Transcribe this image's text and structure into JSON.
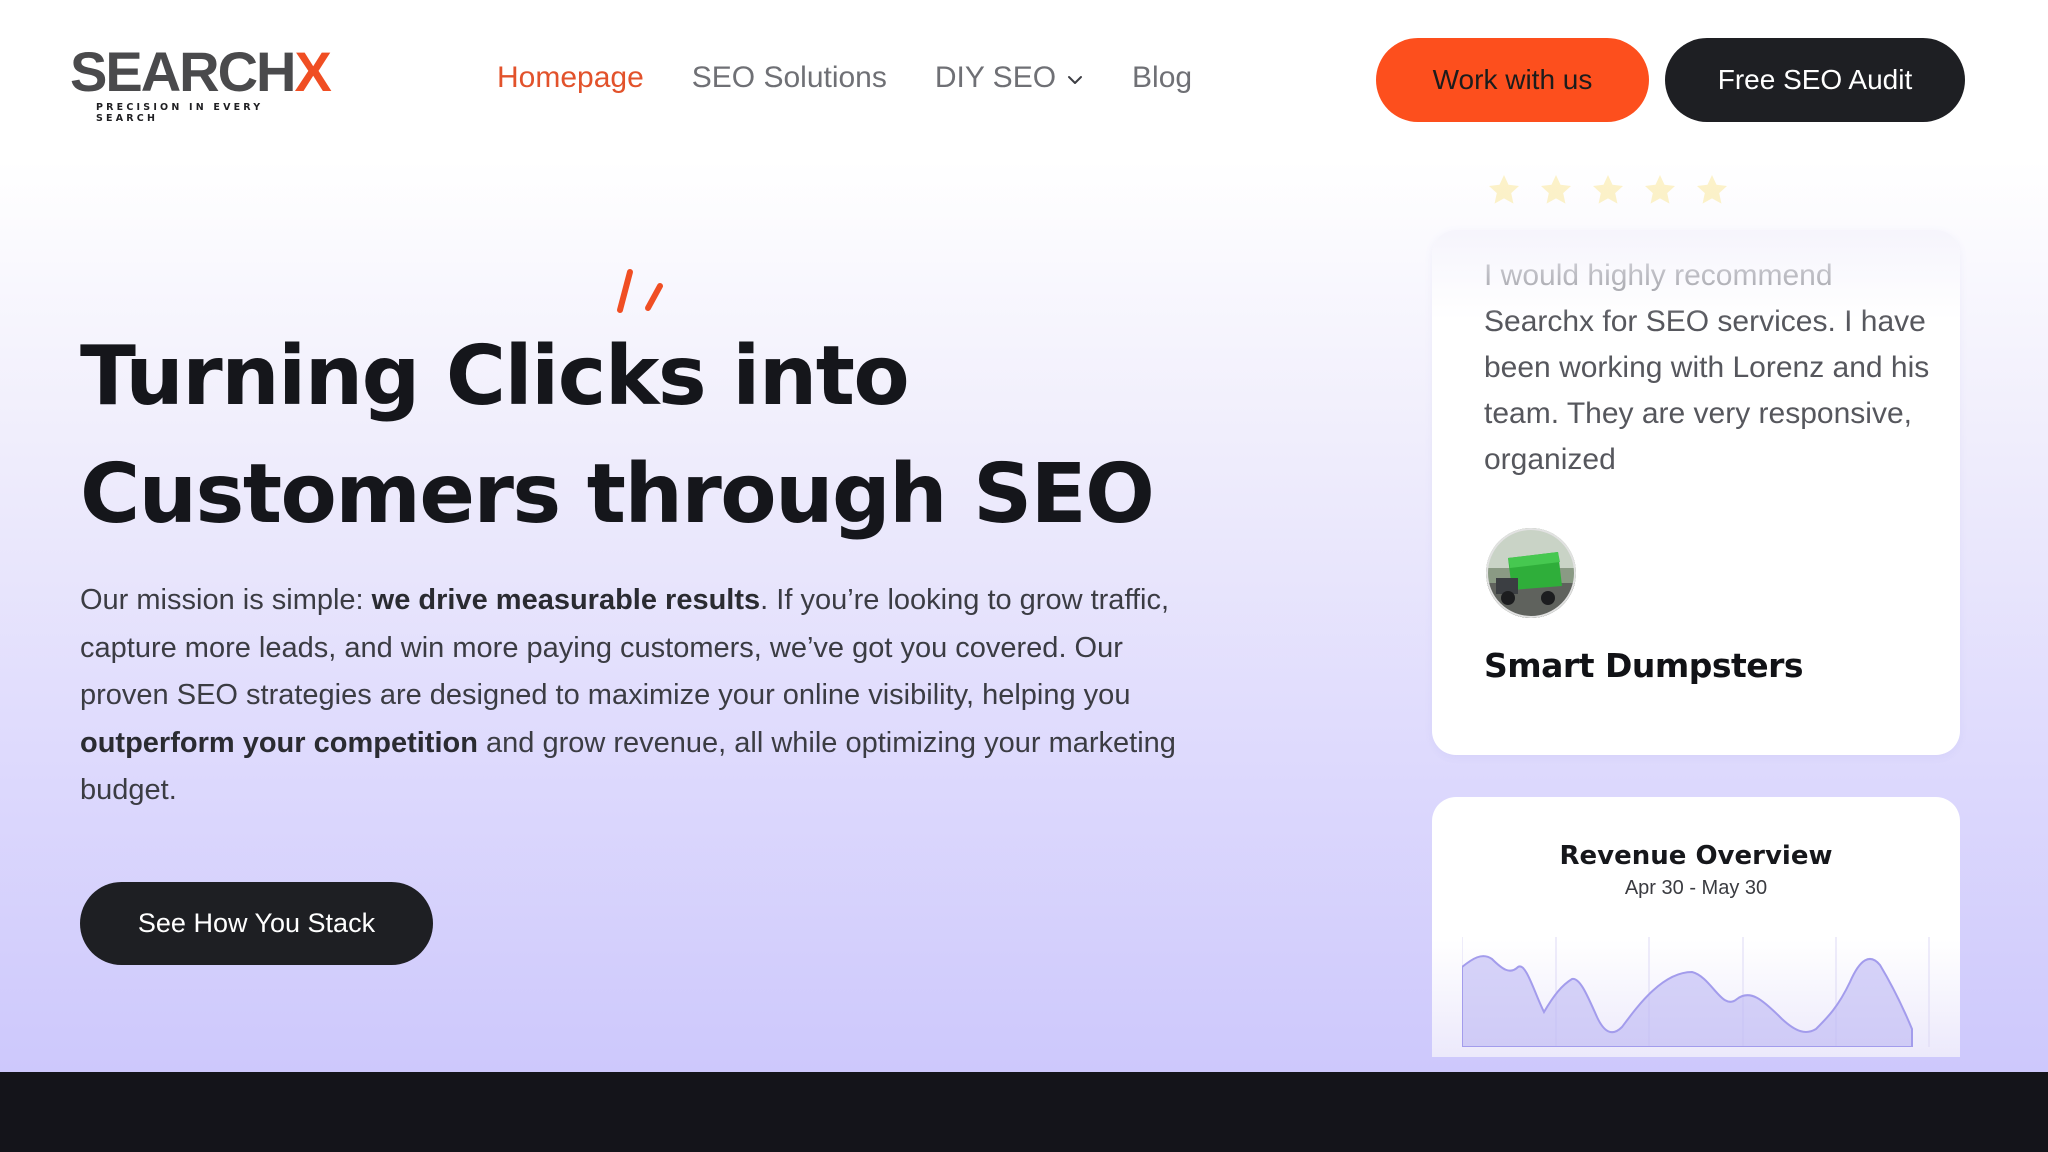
{
  "brand": {
    "name": "SEARCH",
    "name_x": "X",
    "tagline": "PRECISION IN EVERY SEARCH",
    "accent_color": "#f04e23"
  },
  "nav": {
    "links": [
      {
        "label": "Homepage",
        "active": true
      },
      {
        "label": "SEO Solutions"
      },
      {
        "label": "DIY SEO",
        "icon": "chevron-down-icon"
      },
      {
        "label": "Blog"
      }
    ],
    "work_button": "Work with us",
    "audit_button": "Free SEO Audit"
  },
  "hero": {
    "headline_line1": "Turning Clicks into",
    "headline_line2": "Customers through SEO",
    "desc_1": "Our mission is simple: ",
    "desc_bold_1": "we drive measurable results",
    "desc_2": ". If you’re looking to grow traffic, capture more leads, and win more paying customers, we’ve got you covered. Our proven SEO strategies are designed to maximize your online visibility, helping you ",
    "desc_bold_2": "outperform your competition",
    "desc_3": " and grow revenue, all while optimizing your marketing budget.",
    "cta": "See How You Stack"
  },
  "testimonial": {
    "rating": 5,
    "quote_line1": "I would highly recommend",
    "quote_rest": "Searchx for SEO services. I have been working with Lorenz and his team. They are very responsive, organized",
    "client": "Smart Dumpsters",
    "avatar_icon": "dumpster-truck-avatar"
  },
  "revenue": {
    "title": "Revenue Overview",
    "date_range": "Apr 30 - May 30"
  },
  "colors": {
    "cta_orange": "#fd4f1d",
    "dark": "#1e1f23",
    "star": "#f7d84b",
    "chart_fill": "#b7b1f2"
  }
}
